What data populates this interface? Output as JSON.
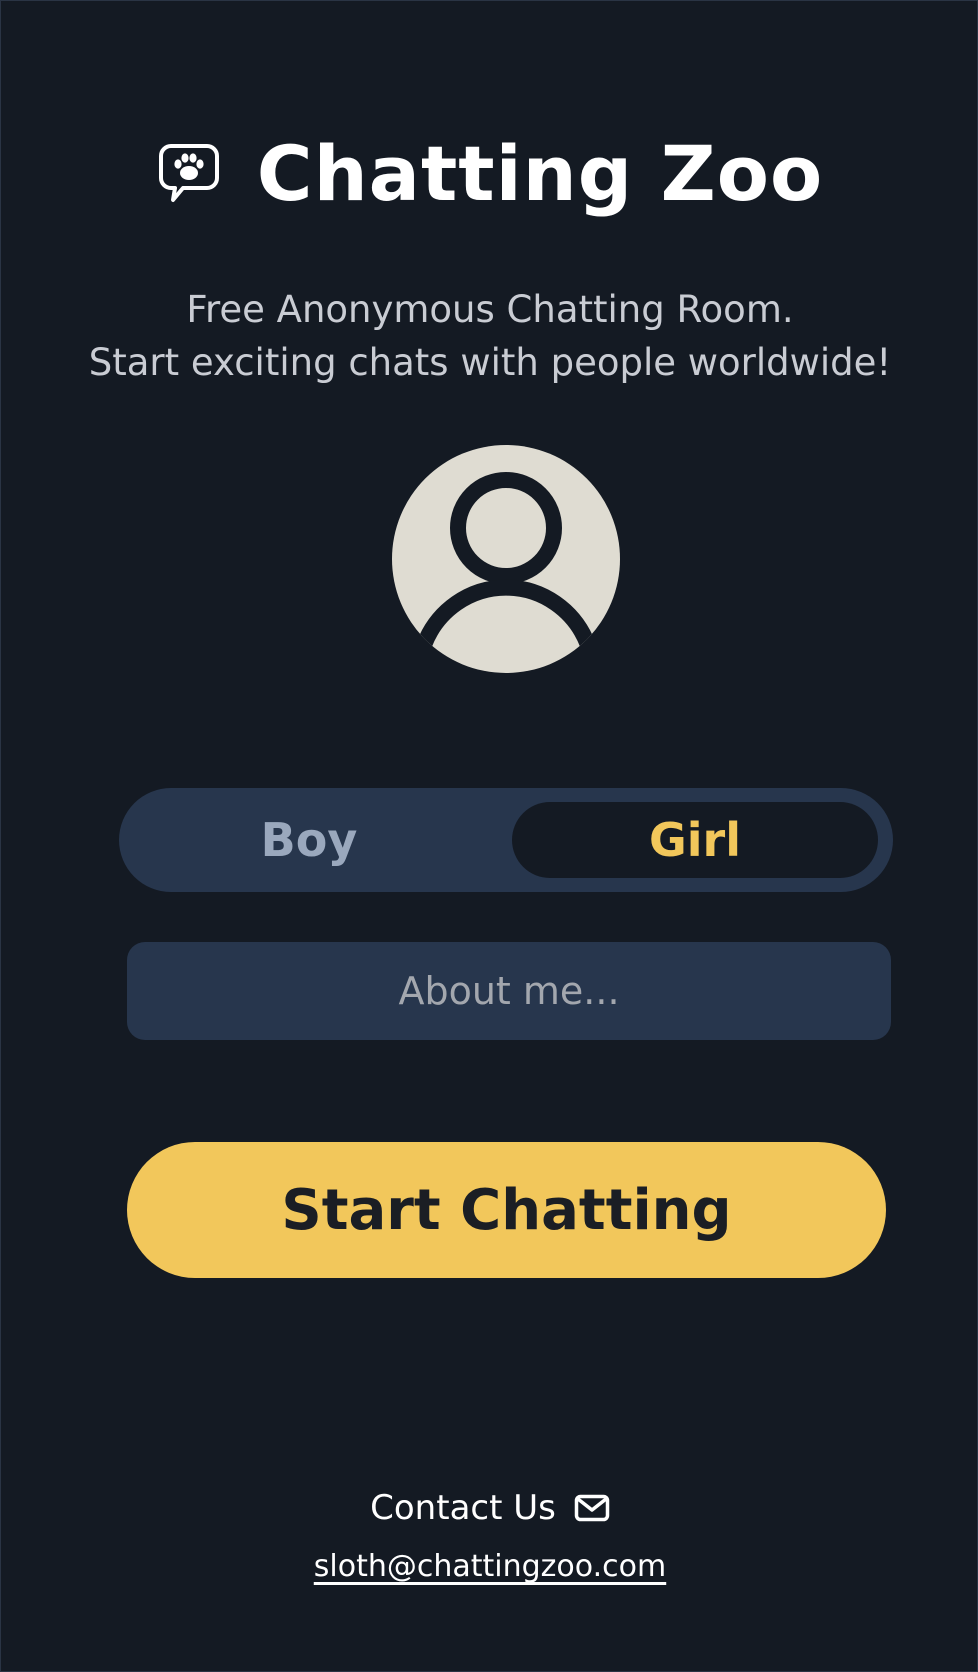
{
  "brand": {
    "title": "Chatting Zoo",
    "icon": "paw-chat-bubble-icon"
  },
  "subtitle": {
    "line1": "Free Anonymous Chatting Room.",
    "line2": "Start exciting chats with people worldwide!"
  },
  "avatar": {
    "icon": "user-avatar-icon"
  },
  "gender": {
    "options": [
      "Boy",
      "Girl"
    ],
    "selected": "Girl"
  },
  "about": {
    "placeholder": "About me...",
    "value": ""
  },
  "start": {
    "label": "Start Chatting"
  },
  "footer": {
    "contact_label": "Contact Us",
    "contact_icon": "envelope-icon",
    "email": "sloth@chattingzoo.com"
  },
  "colors": {
    "background": "#141a23",
    "panel": "#27364d",
    "accent": "#f2c75b",
    "muted": "#9aa8bd"
  }
}
